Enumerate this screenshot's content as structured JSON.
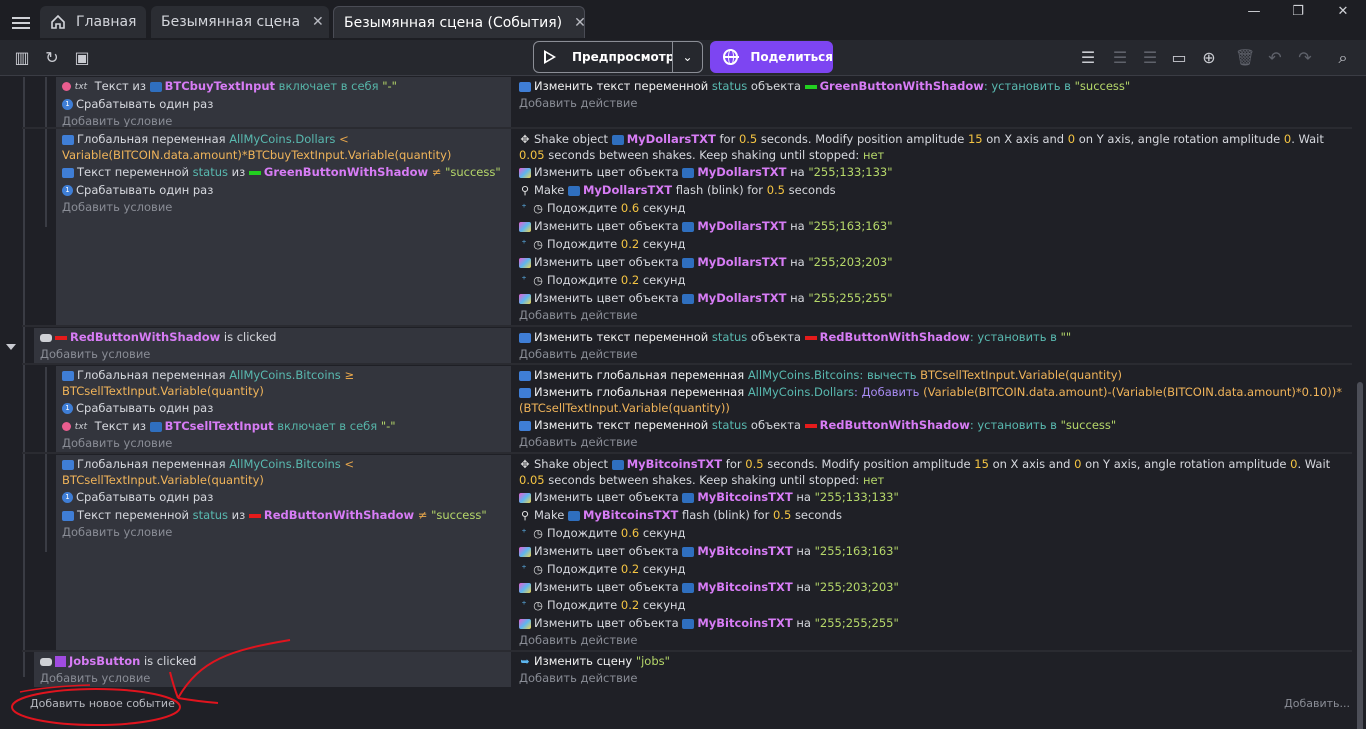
{
  "tabs": [
    {
      "label": "Главная"
    },
    {
      "label": "Безымянная сцена"
    },
    {
      "label": "Безымянная сцена (События)"
    }
  ],
  "window": {
    "minimize": "—",
    "maximize": "❐",
    "close": "✕"
  },
  "toolbar": {
    "preview_label": "Предпросмотр",
    "share_label": "Поделиться"
  },
  "common": {
    "add_condition": "Добавить условие",
    "add_action": "Добавить действие",
    "add_event": "Добавить новое событие",
    "add_more": "Добавить..."
  },
  "blocks": {
    "b1": {
      "cond1": {
        "prefix": "Текст из",
        "obj": "BTCbuyTextInput",
        "mid": "включает в себя",
        "val": "\"-\""
      },
      "cond2": "Срабатывать один раз",
      "act1": {
        "a": "Изменить текст переменной",
        "var": "status",
        "b": "объекта",
        "obj": "GreenButtonWithShadow",
        "c": ": установить в",
        "val": "\"success\""
      }
    },
    "b2": {
      "cond1": {
        "a": "Глобальная переменная",
        "var": "AllMyCoins.Dollars",
        "op": "<",
        "expr": "Variable(BITCOIN.data.amount)*BTCbuyTextInput.Variable(quantity)"
      },
      "cond2": {
        "a": "Текст переменной",
        "var": "status",
        "b": "из",
        "obj": "GreenButtonWithShadow",
        "op": "≠",
        "val": "\"success\""
      },
      "cond3": "Срабатывать один раз",
      "shake": {
        "a": "Shake object",
        "obj": "MyDollarsTXT",
        "b": "for",
        "t": "0.5",
        "c": "seconds. Modify position amplitude",
        "x": "15",
        "d": "on X axis and",
        "y": "0",
        "e": "on Y axis, angle rotation amplitude",
        "ang": "0",
        "f": ". Wait",
        "w": "0.05",
        "g": "seconds between shakes. Keep shaking until stopped:",
        "keep": "нет"
      },
      "color1": {
        "a": "Изменить цвет объекта",
        "obj": "MyDollarsTXT",
        "b": "на",
        "val": "\"255;133;133\""
      },
      "flash": {
        "a": "Make",
        "obj": "MyDollarsTXT",
        "b": "flash (blink) for",
        "t": "0.5",
        "c": "seconds"
      },
      "wait1": {
        "a": "Подождите",
        "t": "0.6",
        "b": "секунд"
      },
      "color2": {
        "a": "Изменить цвет объекта",
        "obj": "MyDollarsTXT",
        "b": "на",
        "val": "\"255;163;163\""
      },
      "wait2": {
        "a": "Подождите",
        "t": "0.2",
        "b": "секунд"
      },
      "color3": {
        "a": "Изменить цвет объекта",
        "obj": "MyDollarsTXT",
        "b": "на",
        "val": "\"255;203;203\""
      },
      "wait3": {
        "a": "Подождите",
        "t": "0.2",
        "b": "секунд"
      },
      "color4": {
        "a": "Изменить цвет объекта",
        "obj": "MyDollarsTXT",
        "b": "на",
        "val": "\"255;255;255\""
      }
    },
    "b3": {
      "cond1": {
        "obj": "RedButtonWithShadow",
        "b": "is clicked"
      },
      "act1": {
        "a": "Изменить текст переменной",
        "var": "status",
        "b": "объекта",
        "obj": "RedButtonWithShadow",
        "c": ": установить в",
        "val": "\"\""
      }
    },
    "b4": {
      "cond1": {
        "a": "Глобальная переменная",
        "var": "AllMyCoins.Bitcoins",
        "op": "≥",
        "expr": "BTCsellTextInput.Variable(quantity)"
      },
      "cond2": "Срабатывать один раз",
      "cond3": {
        "prefix": "Текст из",
        "obj": "BTCsellTextInput",
        "mid": "включает в себя",
        "val": "\"-\""
      },
      "act1": {
        "a": "Изменить глобальная переменная",
        "var": "AllMyCoins.Bitcoins",
        "b": ": вычесть",
        "expr": "BTCsellTextInput.Variable(quantity)"
      },
      "act2": {
        "a": "Изменить глобальная переменная",
        "var": "AllMyCoins.Dollars",
        "b": ": Добавить",
        "expr": "(Variable(BITCOIN.data.amount)-(Variable(BITCOIN.data.amount)*0.10))*(BTCsellTextInput.Variable(quantity))"
      },
      "act3": {
        "a": "Изменить текст переменной",
        "var": "status",
        "b": "объекта",
        "obj": "RedButtonWithShadow",
        "c": ": установить в",
        "val": "\"success\""
      }
    },
    "b5": {
      "cond1": {
        "a": "Глобальная переменная",
        "var": "AllMyCoins.Bitcoins",
        "op": "<",
        "expr": "BTCsellTextInput.Variable(quantity)"
      },
      "cond2": "Срабатывать один раз",
      "cond3": {
        "a": "Текст переменной",
        "var": "status",
        "b": "из",
        "obj": "RedButtonWithShadow",
        "op": "≠",
        "val": "\"success\""
      },
      "shake": {
        "a": "Shake object",
        "obj": "MyBitcoinsTXT",
        "b": "for",
        "t": "0.5",
        "c": "seconds. Modify position amplitude",
        "x": "15",
        "d": "on X axis and",
        "y": "0",
        "e": "on Y axis, angle rotation amplitude",
        "ang": "0",
        "f": ". Wait",
        "w": "0.05",
        "g": "seconds between shakes. Keep shaking until stopped:",
        "keep": "нет"
      },
      "color1": {
        "a": "Изменить цвет объекта",
        "obj": "MyBitcoinsTXT",
        "b": "на",
        "val": "\"255;133;133\""
      },
      "flash": {
        "a": "Make",
        "obj": "MyBitcoinsTXT",
        "b": "flash (blink) for",
        "t": "0.5",
        "c": "seconds"
      },
      "wait1": {
        "a": "Подождите",
        "t": "0.6",
        "b": "секунд"
      },
      "color2": {
        "a": "Изменить цвет объекта",
        "obj": "MyBitcoinsTXT",
        "b": "на",
        "val": "\"255;163;163\""
      },
      "wait2": {
        "a": "Подождите",
        "t": "0.2",
        "b": "секунд"
      },
      "color3": {
        "a": "Изменить цвет объекта",
        "obj": "MyBitcoinsTXT",
        "b": "на",
        "val": "\"255;203;203\""
      },
      "wait3": {
        "a": "Подождите",
        "t": "0.2",
        "b": "секунд"
      },
      "color4": {
        "a": "Изменить цвет объекта",
        "obj": "MyBitcoinsTXT",
        "b": "на",
        "val": "\"255;255;255\""
      }
    },
    "b6": {
      "cond1": {
        "obj": "JobsButton",
        "b": "is clicked"
      },
      "act1": {
        "a": "Изменить сцену",
        "val": "\"jobs\""
      }
    }
  },
  "colors": {
    "accent": "#7d45f2",
    "object": "#d77cf5",
    "variable": "#59b9b0",
    "string": "#b6d86a",
    "number": "#f5c543",
    "annotation": "#e0141e"
  }
}
